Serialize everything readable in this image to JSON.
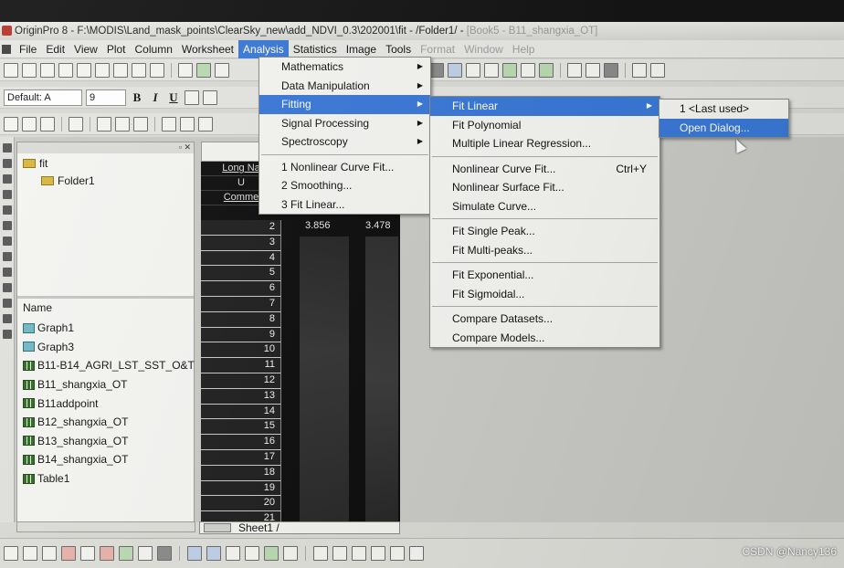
{
  "titlebar": {
    "text": "OriginPro 8 - F:\\MODIS\\Land_mask_points\\ClearSky_new\\add_NDVI_0.3\\202001\\fit - /Folder1/ -",
    "faded": "[Book5 - B11_shangxia_OT]"
  },
  "menubar": {
    "items": [
      "File",
      "Edit",
      "View",
      "Plot",
      "Column",
      "Worksheet",
      "Analysis",
      "Statistics",
      "Image",
      "Tools",
      "Format",
      "Window",
      "Help"
    ],
    "active": "Analysis"
  },
  "toolbar2": {
    "font_name": "Default: A",
    "font_size": "9",
    "bold": "B",
    "italic": "I",
    "underline": "U"
  },
  "explorer": {
    "root": "fit",
    "folder": "Folder1",
    "list_header": "Name",
    "items": [
      {
        "label": "Graph1",
        "icon": "graph-icon"
      },
      {
        "label": "Graph3",
        "icon": "graph-icon"
      },
      {
        "label": "B11-B14_AGRI_LST_SST_O&T",
        "icon": "workbook-icon"
      },
      {
        "label": "B11_shangxia_OT",
        "icon": "workbook-icon"
      },
      {
        "label": "B11addpoint",
        "icon": "workbook-icon"
      },
      {
        "label": "B12_shangxia_OT",
        "icon": "workbook-icon"
      },
      {
        "label": "B13_shangxia_OT",
        "icon": "workbook-icon"
      },
      {
        "label": "B14_shangxia_OT",
        "icon": "workbook-icon"
      },
      {
        "label": "Table1",
        "icon": "workbook-icon"
      }
    ]
  },
  "worksheet": {
    "labels": [
      "Long Na",
      "U",
      "Comme"
    ],
    "rows": [
      "2",
      "3",
      "4",
      "5",
      "6",
      "7",
      "8",
      "9",
      "10",
      "11",
      "12",
      "13",
      "14",
      "15",
      "16",
      "17",
      "18",
      "19",
      "20",
      "21"
    ],
    "cell_a": "3.856",
    "cell_b": "3.478",
    "sheet_tab": "Sheet1 /"
  },
  "analysis_menu": {
    "items": [
      "Mathematics",
      "Data Manipulation",
      "Fitting",
      "Signal Processing",
      "Spectroscopy"
    ],
    "recent": [
      "1 Nonlinear Curve Fit...",
      "2 Smoothing...",
      "3 Fit Linear..."
    ]
  },
  "fitting_menu": {
    "group1": [
      "Fit Linear",
      "Fit Polynomial",
      "Multiple Linear Regression..."
    ],
    "group2": [
      "Nonlinear Curve Fit...",
      "Nonlinear Surface Fit...",
      "Simulate Curve..."
    ],
    "nonlinear_shortcut": "Ctrl+Y",
    "group3": [
      "Fit Single Peak...",
      "Fit Multi-peaks..."
    ],
    "group4": [
      "Fit Exponential...",
      "Fit Sigmoidal..."
    ],
    "group5": [
      "Compare Datasets...",
      "Compare Models..."
    ]
  },
  "fitlinear_menu": {
    "items": [
      "1 <Last used>",
      "Open Dialog..."
    ]
  },
  "watermark": "CSDN @Nancy136",
  "colors": {
    "highlight": "#3a78d6",
    "worksheet_bg": "#0e0e0e",
    "menu_bg": "#f3f3f0"
  }
}
